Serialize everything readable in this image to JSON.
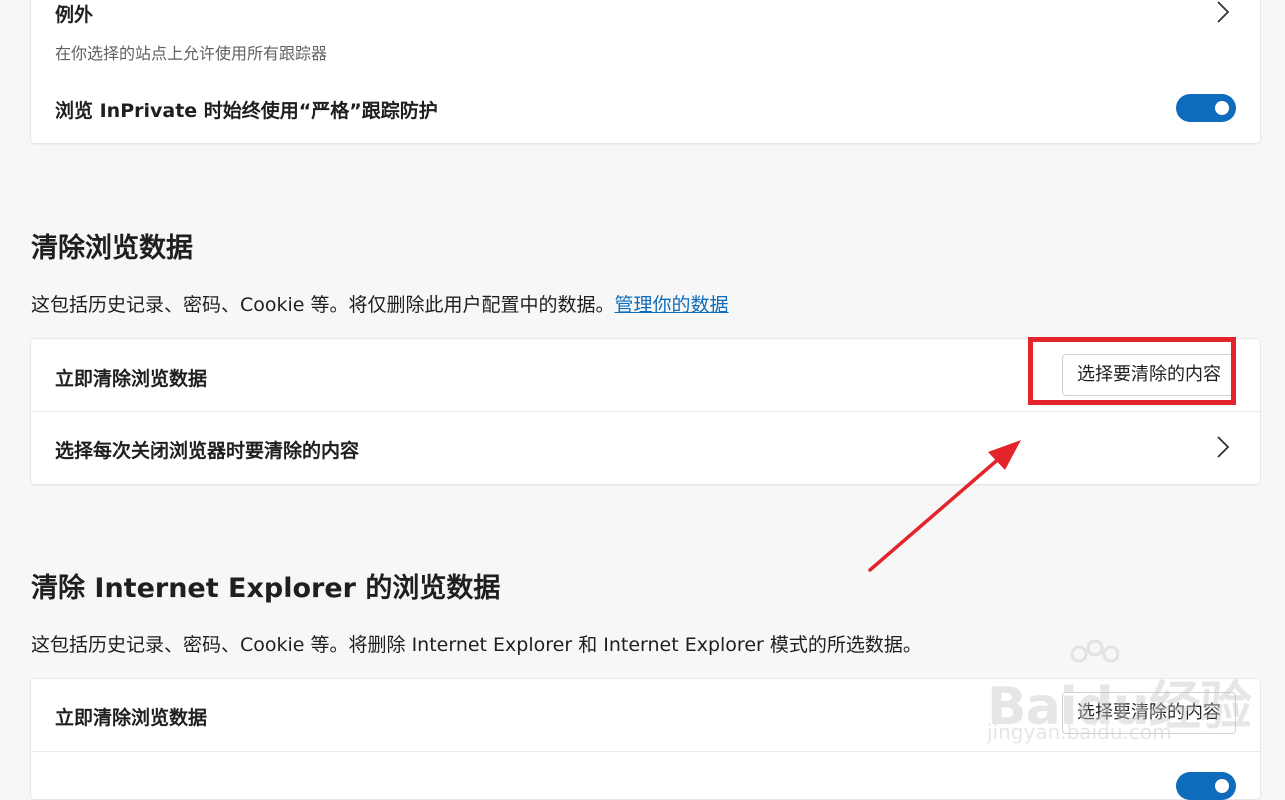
{
  "tracking_card": {
    "exceptions_title": "例外",
    "exceptions_desc": "在你选择的站点上允许使用所有跟踪器",
    "inprivate_label": "浏览 InPrivate 时始终使用“严格”跟踪防护",
    "inprivate_toggle_on": true
  },
  "clear_data": {
    "title": "清除浏览数据",
    "desc": "这包括历史记录、密码、Cookie 等。将仅删除此用户配置中的数据。",
    "manage_link": "管理你的数据",
    "row_clear_now": "立即清除浏览数据",
    "choose_button": "选择要清除的内容",
    "row_on_close": "选择每次关闭浏览器时要清除的内容"
  },
  "clear_ie": {
    "title": "清除 Internet Explorer 的浏览数据",
    "desc": "这包括历史记录、密码、Cookie 等。将删除 Internet Explorer 和 Internet Explorer 模式的所选数据。",
    "row_clear_now": "立即清除浏览数据",
    "choose_button": "选择要清除的内容"
  },
  "watermark": {
    "text": "Baidu经验",
    "sub": "jingyan.baidu.com"
  },
  "colors": {
    "accent": "#0f6cbd",
    "annotation_red": "#e3242b",
    "background": "#f7f7f7"
  }
}
